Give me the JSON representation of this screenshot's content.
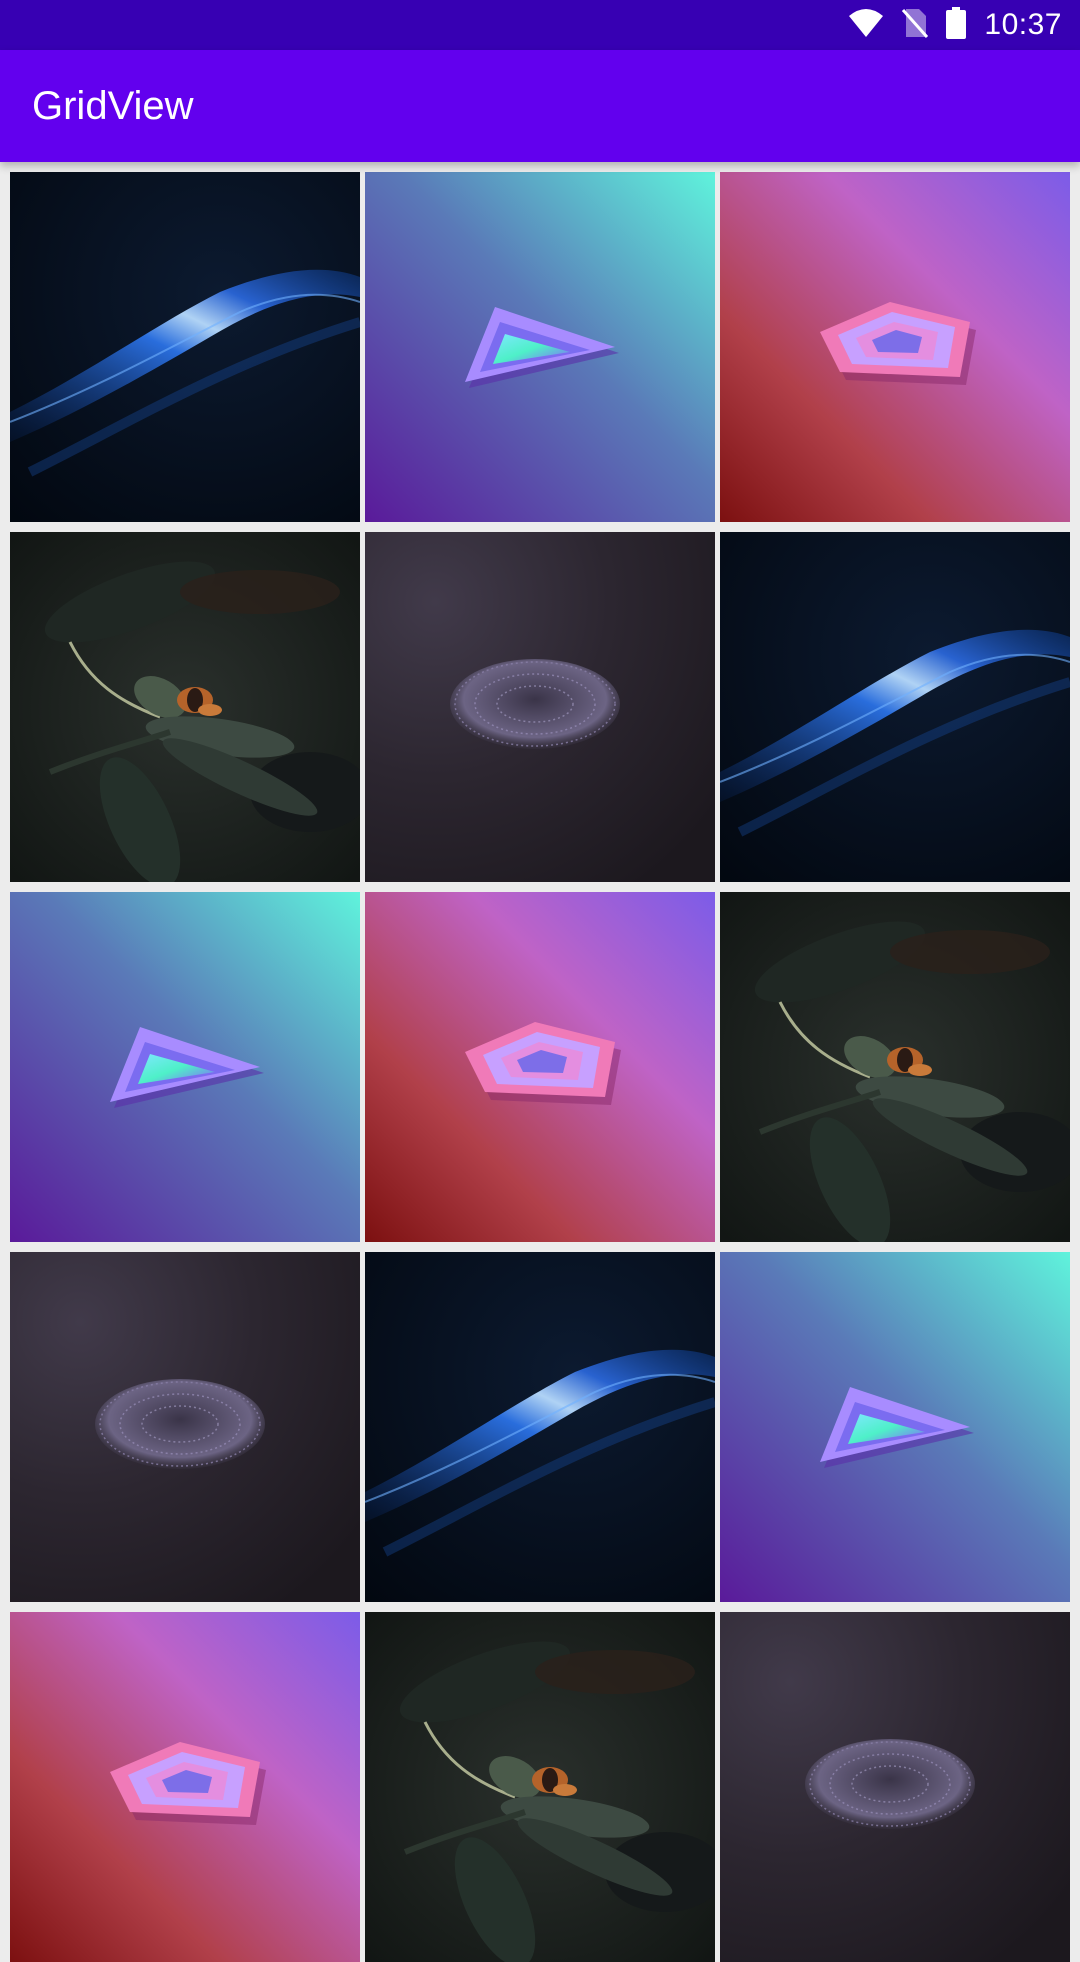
{
  "status_bar": {
    "time": "10:37",
    "icons": [
      "wifi-icon",
      "no-sim-icon",
      "battery-icon"
    ],
    "background": "#3700b3"
  },
  "app_bar": {
    "title": "GridView",
    "background": "#6200ee"
  },
  "grid": {
    "columns": 3,
    "items": [
      {
        "image": "blue-wave"
      },
      {
        "image": "teal-triangle"
      },
      {
        "image": "pink-pentagon"
      },
      {
        "image": "butterfly-leaf"
      },
      {
        "image": "dark-sphere"
      },
      {
        "image": "blue-wave"
      },
      {
        "image": "teal-triangle"
      },
      {
        "image": "pink-pentagon"
      },
      {
        "image": "butterfly-leaf"
      },
      {
        "image": "dark-sphere"
      },
      {
        "image": "blue-wave"
      },
      {
        "image": "teal-triangle"
      },
      {
        "image": "pink-pentagon"
      },
      {
        "image": "butterfly-leaf"
      },
      {
        "image": "dark-sphere"
      }
    ]
  }
}
